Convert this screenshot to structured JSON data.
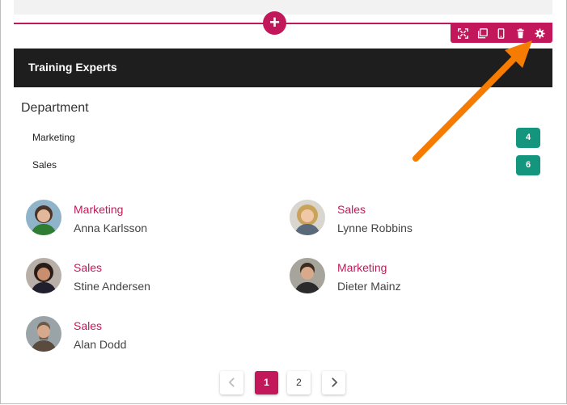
{
  "editor": {
    "add_label": "+",
    "toolbar": [
      {
        "icon": "fullscreen-icon"
      },
      {
        "icon": "duplicate-icon"
      },
      {
        "icon": "mobile-icon"
      },
      {
        "icon": "trash-icon"
      },
      {
        "icon": "gear-icon"
      }
    ]
  },
  "widget": {
    "title": "Training Experts",
    "department_label": "Department",
    "departments": [
      {
        "name": "Marketing",
        "count": "4"
      },
      {
        "name": "Sales",
        "count": "6"
      }
    ],
    "people": [
      {
        "dept": "Marketing",
        "name": "Anna Karlsson"
      },
      {
        "dept": "Sales",
        "name": "Lynne Robbins"
      },
      {
        "dept": "Sales",
        "name": "Stine Andersen"
      },
      {
        "dept": "Marketing",
        "name": "Dieter Mainz"
      },
      {
        "dept": "Sales",
        "name": "Alan Dodd"
      }
    ]
  },
  "pagination": {
    "pages": [
      "1",
      "2"
    ],
    "current": "1"
  },
  "colors": {
    "accent": "#c2185b",
    "badge": "#13957e",
    "header": "#1e1e1e",
    "annotation_arrow": "#f57c00"
  }
}
